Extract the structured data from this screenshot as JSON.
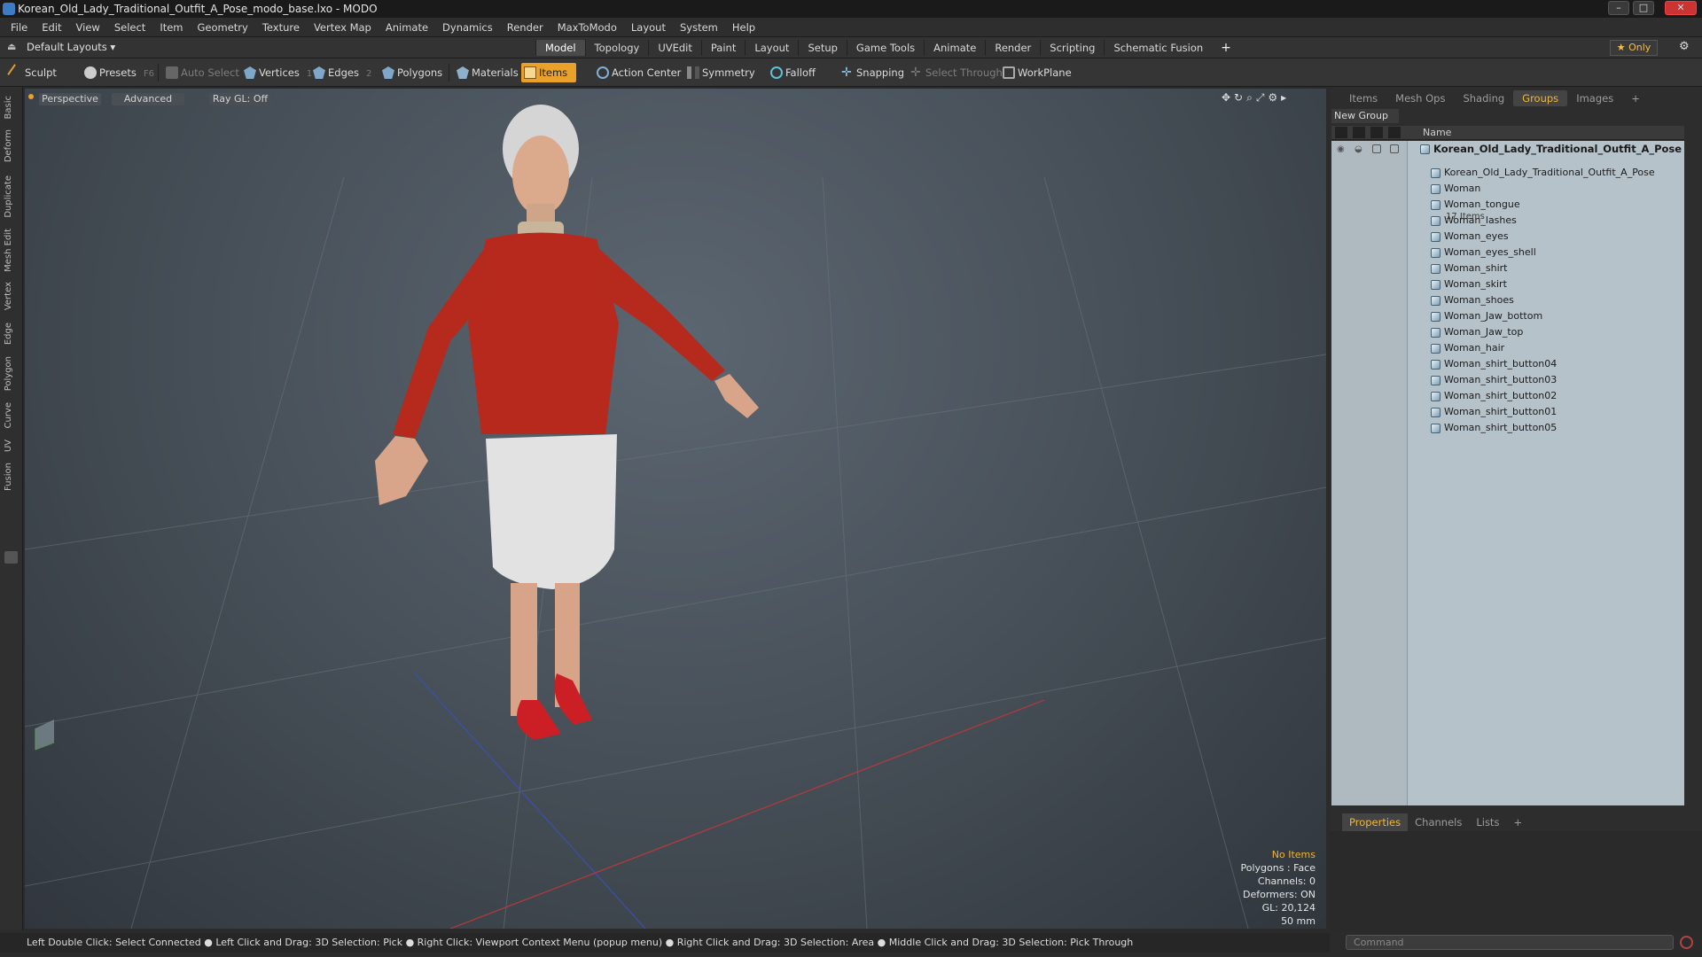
{
  "window": {
    "title": "Korean_Old_Lady_Traditional_Outfit_A_Pose_modo_base.lxo - MODO"
  },
  "menu": [
    "File",
    "Edit",
    "View",
    "Select",
    "Item",
    "Geometry",
    "Texture",
    "Vertex Map",
    "Animate",
    "Dynamics",
    "Render",
    "MaxToModo",
    "Layout",
    "System",
    "Help"
  ],
  "layout_dropdown": "Default Layouts ▾",
  "mode_tabs": [
    "Model",
    "Topology",
    "UVEdit",
    "Paint",
    "Layout",
    "Setup",
    "Game Tools",
    "Animate",
    "Render",
    "Scripting",
    "Schematic Fusion"
  ],
  "only_button": "Only",
  "toolbar": {
    "sculpt": "Sculpt",
    "presets": "Presets",
    "presets_key": "F6",
    "auto_select": "Auto Select",
    "vertices": "Vertices",
    "vertices_key": "1",
    "edges": "Edges",
    "edges_key": "2",
    "polygons": "Polygons",
    "materials": "Materials",
    "items": "Items",
    "action_center": "Action Center",
    "symmetry": "Symmetry",
    "falloff": "Falloff",
    "snapping": "Snapping",
    "select_through": "Select Through",
    "workplane": "WorkPlane"
  },
  "left_tabs": [
    "Basic",
    "Deform",
    "Duplicate",
    "Mesh Edit",
    "Vertex",
    "Edge",
    "Polygon",
    "Curve",
    "UV",
    "Fusion"
  ],
  "viewport": {
    "view": "Perspective",
    "advanced": "Advanced",
    "raygl": "Ray GL: Off",
    "info": {
      "items": "No Items",
      "polygons": "Polygons : Face",
      "channels": "Channels: 0",
      "deformers": "Deformers: ON",
      "gl": "GL: 20,124",
      "scale": "50 mm"
    }
  },
  "status_text": "Left Double Click: Select Connected ● Left Click and Drag: 3D Selection: Pick ● Right Click: Viewport Context Menu (popup menu) ● Right Click and Drag: 3D Selection: Area ● Middle Click and Drag: 3D Selection: Pick Through",
  "right_panel": {
    "tabs": [
      "Items",
      "Mesh Ops",
      "Shading",
      "Groups",
      "Images"
    ],
    "active_tab": "Groups",
    "new_group": "New Group",
    "name_header": "Name",
    "group_name": "Korean_Old_Lady_Traditional_Outfit_A_Pose",
    "group_count": "17 Items",
    "items": [
      "Korean_Old_Lady_Traditional_Outfit_A_Pose",
      "Woman",
      "Woman_tongue",
      "Woman_lashes",
      "Woman_eyes",
      "Woman_eyes_shell",
      "Woman_shirt",
      "Woman_skirt",
      "Woman_shoes",
      "Woman_Jaw_bottom",
      "Woman_Jaw_top",
      "Woman_hair",
      "Woman_shirt_button04",
      "Woman_shirt_button03",
      "Woman_shirt_button02",
      "Woman_shirt_button01",
      "Woman_shirt_button05"
    ]
  },
  "properties_tabs": [
    "Properties",
    "Channels",
    "Lists"
  ],
  "command_placeholder": "Command",
  "colors": {
    "accent": "#f0b638",
    "items_button": "#e9a12a",
    "list_bg": "#b6c2c9"
  }
}
